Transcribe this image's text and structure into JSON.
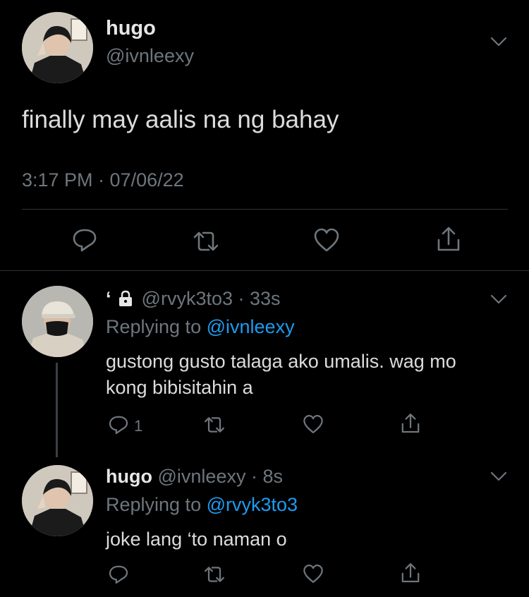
{
  "main_tweet": {
    "display_name": "hugo",
    "handle": "@ivnleexy",
    "text": "finally may aalis na ng bahay",
    "timestamp": "3:17 PM · 07/06/22"
  },
  "reply_1": {
    "display_name": "‘",
    "handle": "@rvyk3to3",
    "time": "· 33s",
    "replying_prefix": "Replying to",
    "replying_to": "@ivnleexy",
    "text_line1": "gustong gusto talaga ako umalis. wag mo",
    "text_line2": "kong bibisitahin a",
    "reply_count": "1"
  },
  "reply_2": {
    "display_name": "hugo",
    "handle": "@ivnleexy",
    "time": "· 8s",
    "replying_prefix": "Replying to",
    "replying_to": "@rvyk3to3",
    "text": "joke lang ‘to naman o"
  },
  "icons": [
    "chevron-down-icon",
    "reply-icon",
    "retweet-icon",
    "like-icon",
    "share-icon",
    "lock-icon"
  ],
  "colors": {
    "background": "#000000",
    "text": "#d9d9d9",
    "muted": "#6e767d",
    "link": "#1d9bf0",
    "divider": "#2f3336"
  }
}
